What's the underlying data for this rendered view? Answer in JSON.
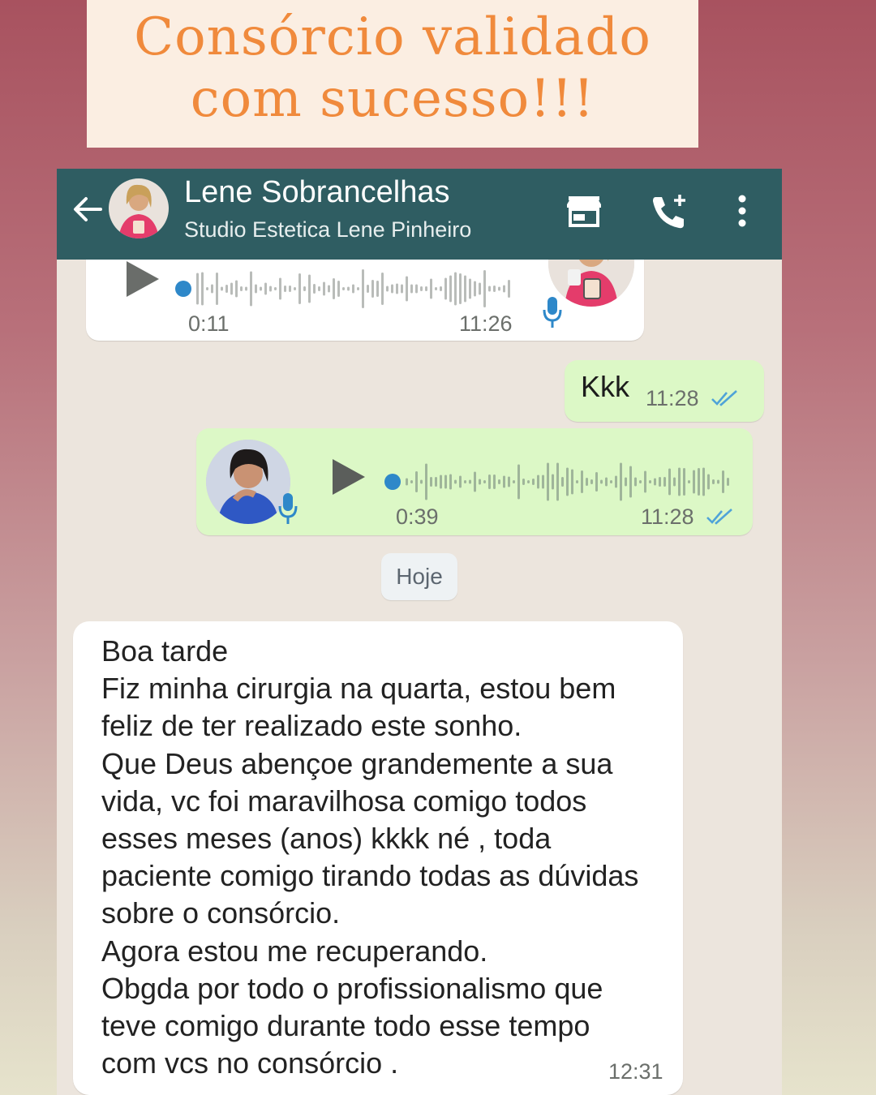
{
  "banner": {
    "title": "Consórcio validado com sucesso!!!"
  },
  "header": {
    "name": "Lene Sobrancelhas",
    "subtitle": "Studio Estetica Lene Pinheiro",
    "icons": [
      "back-arrow-icon",
      "storefront-icon",
      "add-call-icon",
      "more-vertical-icon"
    ]
  },
  "messages": {
    "audio_in": {
      "duration": "0:11",
      "time": "11:26",
      "progress": 0.0
    },
    "text_out": {
      "text": "Kkk",
      "time": "11:28",
      "status": "read"
    },
    "audio_out": {
      "duration": "0:39",
      "time": "11:28",
      "status": "read",
      "progress": 0.0
    },
    "date_divider": "Hoje",
    "text_in": {
      "text": "Boa tarde\nFiz minha cirurgia na quarta, estou bem\nfeliz de ter realizado este sonho.\nQue Deus abençoe grandemente a sua\nvida, vc foi maravilhosa comigo todos\nesses meses (anos) kkkk né , toda\npaciente comigo tirando todas as dúvidas\nsobre o consórcio.\nAgora estou me recuperando.\nObgda por todo o profissionalismo que\nteve comigo durante todo esse tempo\ncom vcs no consórcio .",
      "time": "12:31"
    }
  },
  "colors": {
    "appbar": "#2f5d62",
    "outgoing_bubble": "#dcf8c6",
    "incoming_bubble": "#ffffff",
    "chat_bg": "#ece5dd",
    "read_ticks": "#4fa3d8",
    "banner_text": "#f08a3c"
  }
}
